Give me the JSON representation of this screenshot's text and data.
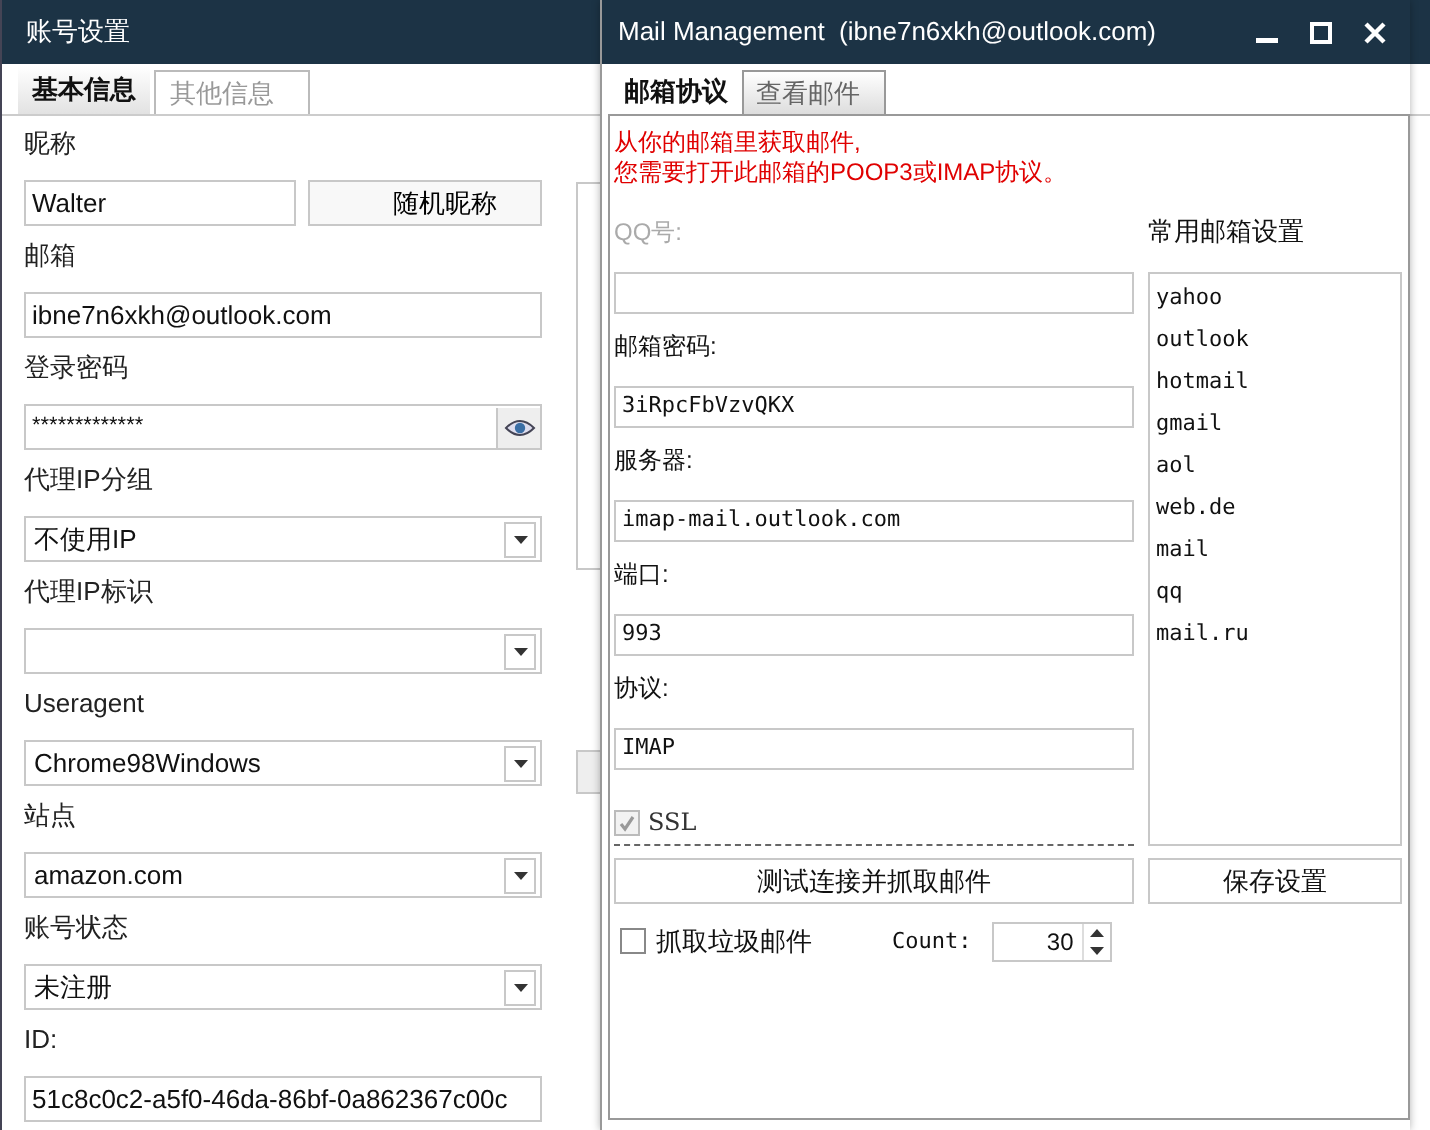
{
  "account_window": {
    "title": "账号设置",
    "tabs": [
      {
        "label": "基本信息",
        "selected": true
      },
      {
        "label": "其他信息",
        "selected": false
      }
    ],
    "fields": [
      {
        "label": "昵称",
        "kind": "text",
        "value": "Walter",
        "button": "随机昵称"
      },
      {
        "label": "邮箱",
        "kind": "text",
        "value": "ibne7n6xkh@outlook.com"
      },
      {
        "label": "登录密码",
        "kind": "password",
        "value": "*************"
      },
      {
        "label": "代理IP分组",
        "kind": "select",
        "value": "不使用IP"
      },
      {
        "label": "代理IP标识",
        "kind": "select"
      },
      {
        "label": "Useragent",
        "kind": "select",
        "value": "Chrome98Windows"
      },
      {
        "label": "站点",
        "kind": "select",
        "value": "amazon.com"
      },
      {
        "label": "账号状态",
        "kind": "select",
        "value": "未注册"
      },
      {
        "label": "ID:",
        "kind": "text",
        "value": "51c8c0c2-a5f0-46da-86bf-0a862367c00c"
      }
    ]
  },
  "mail_window": {
    "title": "Mail Management  (ibne7n6xkh@outlook.com)",
    "tabs": [
      {
        "label": "邮箱协议",
        "selected": true
      },
      {
        "label": "查看邮件",
        "selected": false
      }
    ],
    "notice": [
      "从你的邮箱里获取邮件,",
      "您需要打开此邮箱的POOP3或IMAP协议。"
    ],
    "fields": [
      {
        "label": "QQ号:",
        "disabled": true
      },
      {
        "label": "邮箱密码:",
        "disabled": false,
        "value": "3iRpcFbVzvQKX"
      },
      {
        "label": "服务器:",
        "disabled": false,
        "value": "imap-mail.outlook.com"
      },
      {
        "label": "端口:",
        "disabled": false,
        "value": "993"
      },
      {
        "label": "协议:",
        "disabled": false,
        "value": "IMAP"
      }
    ],
    "ssl": {
      "label": "SSL",
      "checked": true,
      "disabled": true
    },
    "test_button": "测试连接并抓取邮件",
    "junk": {
      "label": "抓取垃圾邮件",
      "checked": false
    },
    "count": {
      "label": "Count:",
      "value": "30"
    },
    "presets": {
      "title": "常用邮箱设置",
      "items": [
        "yahoo",
        "outlook",
        "hotmail",
        "gmail",
        "aol",
        "web.de",
        "mail",
        "qq",
        "mail.ru"
      ]
    },
    "save_button": "保存设置"
  }
}
